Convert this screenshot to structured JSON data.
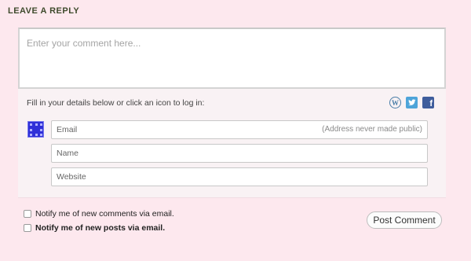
{
  "reply": {
    "title": "LEAVE A REPLY",
    "comment_placeholder": "Enter your comment here..."
  },
  "login": {
    "hint": "Fill in your details below or click an icon to log in:",
    "icons": [
      "wordpress-icon",
      "twitter-icon",
      "facebook-icon"
    ],
    "avatar_color": "#2f2fd8"
  },
  "fields": {
    "email_placeholder": "Email",
    "email_note": "(Address never made public)",
    "name_placeholder": "Name",
    "website_placeholder": "Website"
  },
  "notify": {
    "comments_label": "Notify me of new comments via email.",
    "posts_label": "Notify me of new posts via email."
  },
  "submit": {
    "label": "Post Comment"
  },
  "colors": {
    "page_background": "#fde8ee",
    "title_color": "#3e4a2c"
  }
}
